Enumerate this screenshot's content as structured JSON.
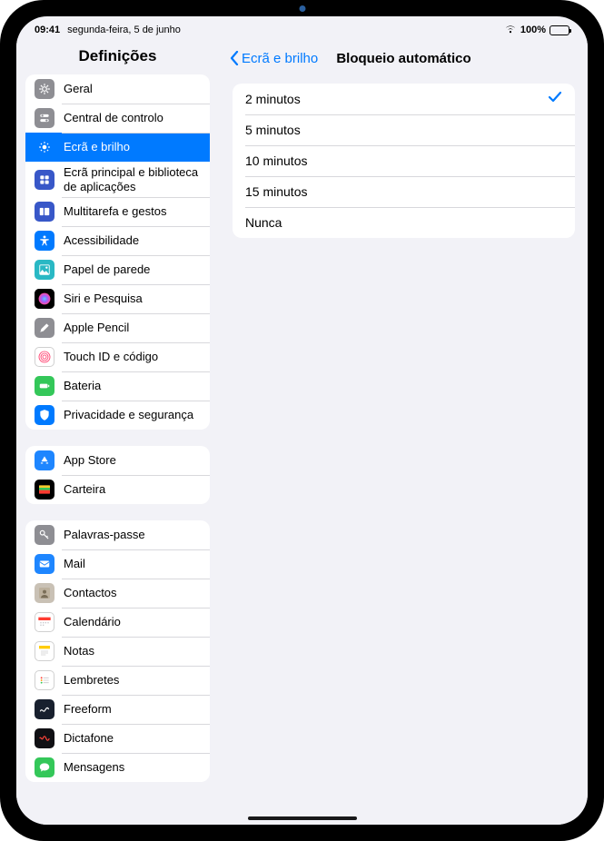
{
  "status": {
    "time": "09:41",
    "date": "segunda-feira, 5 de junho",
    "battery_pct": "100%"
  },
  "sidebar": {
    "title": "Definições",
    "groups": [
      {
        "items": [
          {
            "label": "Geral",
            "icon_name": "gear-icon",
            "icon_bg": "#8e8e93"
          },
          {
            "label": "Central de controlo",
            "icon_name": "switches-icon",
            "icon_bg": "#8e8e93"
          },
          {
            "label": "Ecrã e brilho",
            "icon_name": "brightness-icon",
            "icon_bg": "#007aff",
            "selected": true
          },
          {
            "label": "Ecrã principal e biblioteca de aplicações",
            "icon_name": "homescreen-icon",
            "icon_bg": "#3857c8"
          },
          {
            "label": "Multitarefa e gestos",
            "icon_name": "multitask-icon",
            "icon_bg": "#3857c8"
          },
          {
            "label": "Acessibilidade",
            "icon_name": "accessibility-icon",
            "icon_bg": "#007aff"
          },
          {
            "label": "Papel de parede",
            "icon_name": "wallpaper-icon",
            "icon_bg": "#29b8c4"
          },
          {
            "label": "Siri e Pesquisa",
            "icon_name": "siri-icon",
            "icon_bg": "#000"
          },
          {
            "label": "Apple Pencil",
            "icon_name": "pencil-icon",
            "icon_bg": "#8e8e93"
          },
          {
            "label": "Touch ID e código",
            "icon_name": "touchid-icon",
            "icon_bg": "#fff"
          },
          {
            "label": "Bateria",
            "icon_name": "battery-icon",
            "icon_bg": "#34c759"
          },
          {
            "label": "Privacidade e segurança",
            "icon_name": "privacy-icon",
            "icon_bg": "#007aff"
          }
        ]
      },
      {
        "items": [
          {
            "label": "App Store",
            "icon_name": "appstore-icon",
            "icon_bg": "#1e86ff"
          },
          {
            "label": "Carteira",
            "icon_name": "wallet-icon",
            "icon_bg": "#000"
          }
        ]
      },
      {
        "items": [
          {
            "label": "Palavras-passe",
            "icon_name": "key-icon",
            "icon_bg": "#8e8e93"
          },
          {
            "label": "Mail",
            "icon_name": "mail-icon",
            "icon_bg": "#1e86ff"
          },
          {
            "label": "Contactos",
            "icon_name": "contacts-icon",
            "icon_bg": "#c9c1b5"
          },
          {
            "label": "Calendário",
            "icon_name": "calendar-icon",
            "icon_bg": "#fff"
          },
          {
            "label": "Notas",
            "icon_name": "notes-icon",
            "icon_bg": "#fff"
          },
          {
            "label": "Lembretes",
            "icon_name": "reminders-icon",
            "icon_bg": "#fff"
          },
          {
            "label": "Freeform",
            "icon_name": "freeform-icon",
            "icon_bg": "#18202e"
          },
          {
            "label": "Dictafone",
            "icon_name": "voice-memo-icon",
            "icon_bg": "#101014"
          },
          {
            "label": "Mensagens",
            "icon_name": "messages-icon",
            "icon_bg": "#34c759"
          }
        ]
      }
    ]
  },
  "detail": {
    "back_label": "Ecrã e brilho",
    "title": "Bloqueio automático",
    "options": [
      {
        "label": "2 minutos",
        "checked": true
      },
      {
        "label": "5 minutos",
        "checked": false
      },
      {
        "label": "10 minutos",
        "checked": false
      },
      {
        "label": "15 minutos",
        "checked": false
      },
      {
        "label": "Nunca",
        "checked": false
      }
    ]
  }
}
